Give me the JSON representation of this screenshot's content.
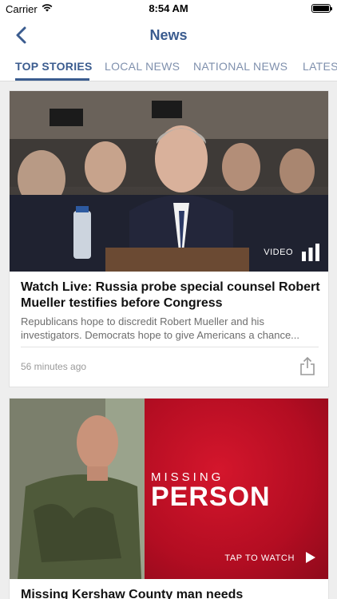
{
  "status_bar": {
    "carrier": "Carrier",
    "time": "8:54 AM"
  },
  "nav": {
    "title": "News"
  },
  "tabs": [
    {
      "label": "TOP STORIES",
      "active": true
    },
    {
      "label": "LOCAL NEWS",
      "active": false
    },
    {
      "label": "NATIONAL NEWS",
      "active": false
    },
    {
      "label": "LATEST",
      "active": false
    }
  ],
  "articles": [
    {
      "media_label": "VIDEO",
      "headline": "Watch Live: Russia probe special counsel Robert Mueller testifies before Congress",
      "summary": "Republicans hope to discredit Robert Mueller and his investigators. Democrats hope to give Americans a chance...",
      "timestamp": "56 minutes ago"
    },
    {
      "overlay_line1": "MISSING",
      "overlay_line2": "PERSON",
      "media_label": "TAP TO WATCH",
      "headline": "Missing Kershaw County man needs"
    }
  ],
  "colors": {
    "accent": "#3b5c8f",
    "tab_inactive": "#7f90ad",
    "missing_red": "#c8102e"
  },
  "icons": [
    "back-chevron-icon",
    "wifi-icon",
    "battery-icon",
    "video-bars-icon",
    "share-icon",
    "play-icon"
  ]
}
